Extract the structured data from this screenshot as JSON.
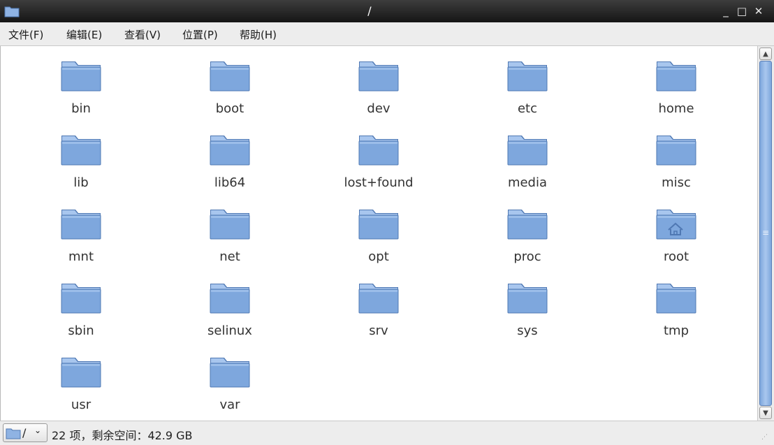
{
  "window": {
    "title": "/"
  },
  "menu": [
    {
      "label": "文件(F)"
    },
    {
      "label": "编辑(E)"
    },
    {
      "label": "查看(V)"
    },
    {
      "label": "位置(P)"
    },
    {
      "label": "帮助(H)"
    }
  ],
  "items": [
    {
      "name": "bin",
      "icon": "folder-icon"
    },
    {
      "name": "boot",
      "icon": "folder-icon"
    },
    {
      "name": "dev",
      "icon": "folder-icon"
    },
    {
      "name": "etc",
      "icon": "folder-icon"
    },
    {
      "name": "home",
      "icon": "folder-icon"
    },
    {
      "name": "lib",
      "icon": "folder-icon"
    },
    {
      "name": "lib64",
      "icon": "folder-icon"
    },
    {
      "name": "lost+found",
      "icon": "folder-icon"
    },
    {
      "name": "media",
      "icon": "folder-icon"
    },
    {
      "name": "misc",
      "icon": "folder-icon"
    },
    {
      "name": "mnt",
      "icon": "folder-icon"
    },
    {
      "name": "net",
      "icon": "folder-icon"
    },
    {
      "name": "opt",
      "icon": "folder-icon"
    },
    {
      "name": "proc",
      "icon": "folder-icon"
    },
    {
      "name": "root",
      "icon": "home-folder-icon"
    },
    {
      "name": "sbin",
      "icon": "folder-icon"
    },
    {
      "name": "selinux",
      "icon": "folder-icon"
    },
    {
      "name": "srv",
      "icon": "folder-icon"
    },
    {
      "name": "sys",
      "icon": "folder-icon"
    },
    {
      "name": "tmp",
      "icon": "folder-icon"
    },
    {
      "name": "usr",
      "icon": "folder-icon"
    },
    {
      "name": "var",
      "icon": "folder-icon"
    }
  ],
  "status": {
    "location_label": "/",
    "text": "22 项，剩余空间：42.9 GB"
  },
  "colors": {
    "folder": "#7ea7dd",
    "folder_dark": "#4f78b3",
    "titlebar": "#222222"
  }
}
